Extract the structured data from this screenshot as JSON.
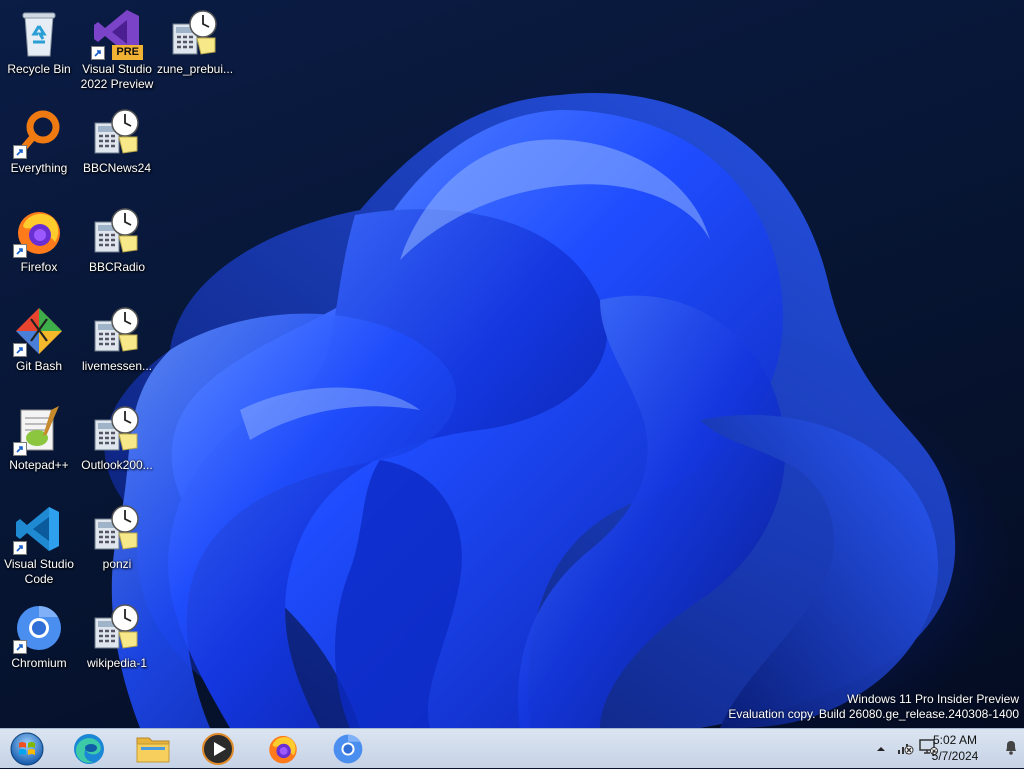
{
  "desktop_icons": [
    {
      "id": "recycle-bin",
      "label": "Recycle Bin",
      "icon": "recycle-bin-icon"
    },
    {
      "id": "visual-studio-2022-preview",
      "label": "Visual Studio 2022 Preview",
      "icon": "visual-studio-icon",
      "badge": "PRE"
    },
    {
      "id": "zune-prebui",
      "label": "zune_prebui...",
      "icon": "calculator-clock-icon"
    },
    {
      "id": "everything",
      "label": "Everything",
      "icon": "everything-search-icon"
    },
    {
      "id": "bbcnews24",
      "label": "BBCNews24",
      "icon": "calculator-clock-icon"
    },
    {
      "id": "firefox",
      "label": "Firefox",
      "icon": "firefox-icon"
    },
    {
      "id": "bbcradio",
      "label": "BBCRadio",
      "icon": "calculator-clock-icon"
    },
    {
      "id": "git-bash",
      "label": "Git Bash",
      "icon": "git-icon"
    },
    {
      "id": "livemessen",
      "label": "livemessen...",
      "icon": "calculator-clock-icon"
    },
    {
      "id": "notepadpp",
      "label": "Notepad++",
      "icon": "notepadpp-icon"
    },
    {
      "id": "outlook200",
      "label": "Outlook200...",
      "icon": "calculator-clock-icon"
    },
    {
      "id": "vscode",
      "label": "Visual Studio Code",
      "icon": "vscode-icon"
    },
    {
      "id": "ponzi",
      "label": "ponzi",
      "icon": "calculator-clock-icon"
    },
    {
      "id": "chromium",
      "label": "Chromium",
      "icon": "chromium-icon"
    },
    {
      "id": "wikipedia-1",
      "label": "wikipedia-1",
      "icon": "calculator-clock-icon"
    }
  ],
  "watermark": {
    "line1": "Windows 11 Pro Insider Preview",
    "line2": "Evaluation copy. Build 26080.ge_release.240308-1400"
  },
  "taskbar": {
    "pinned": [
      {
        "id": "start",
        "icon": "windows-start-orb-icon"
      },
      {
        "id": "edge",
        "icon": "edge-icon"
      },
      {
        "id": "file-explorer",
        "icon": "folder-icon"
      },
      {
        "id": "media-player",
        "icon": "media-player-icon"
      },
      {
        "id": "firefox",
        "icon": "firefox-icon"
      },
      {
        "id": "chromium",
        "icon": "chromium-icon"
      }
    ],
    "tray": {
      "time": "5:02 AM",
      "date": "5/7/2024"
    }
  },
  "colors": {
    "taskbar": "#d1dcec",
    "wallpaper_blue": "#1f4dff",
    "wallpaper_dark": "#06122e"
  }
}
